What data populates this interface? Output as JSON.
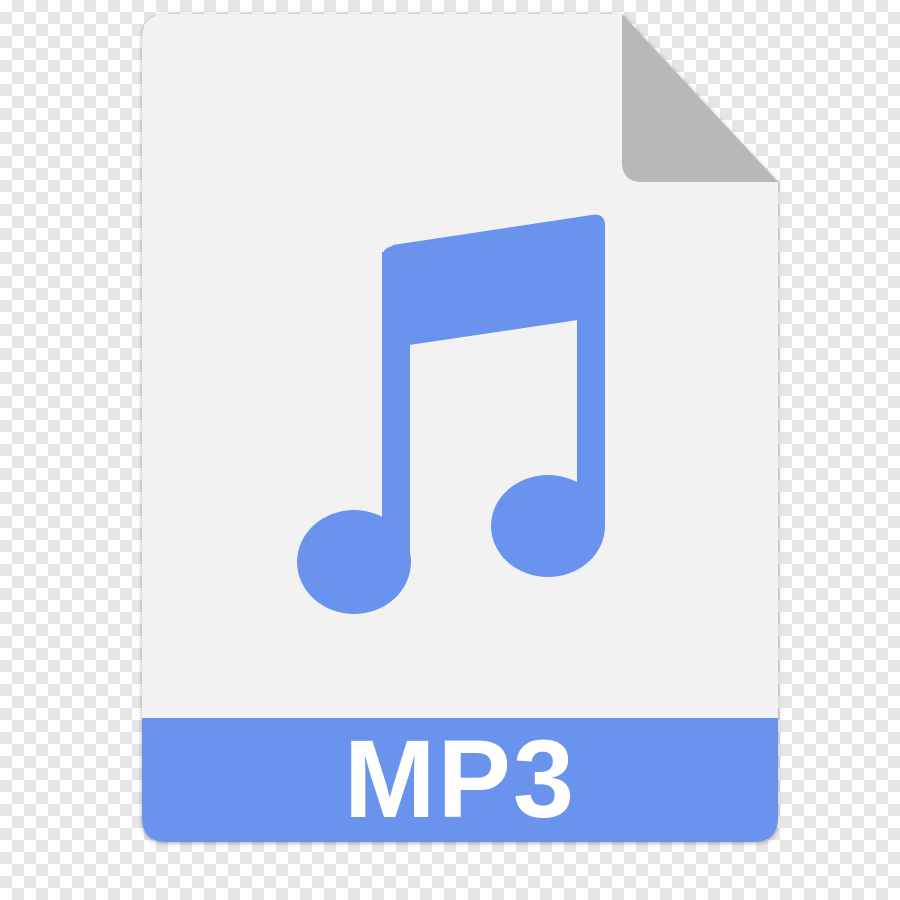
{
  "icon": {
    "name": "music-note-icon",
    "file_type_label": "MP3"
  },
  "colors": {
    "page": "#f2f2f2",
    "folded_corner": "#b8b8b8",
    "accent": "#6a93ee",
    "label_text": "#ffffff"
  }
}
